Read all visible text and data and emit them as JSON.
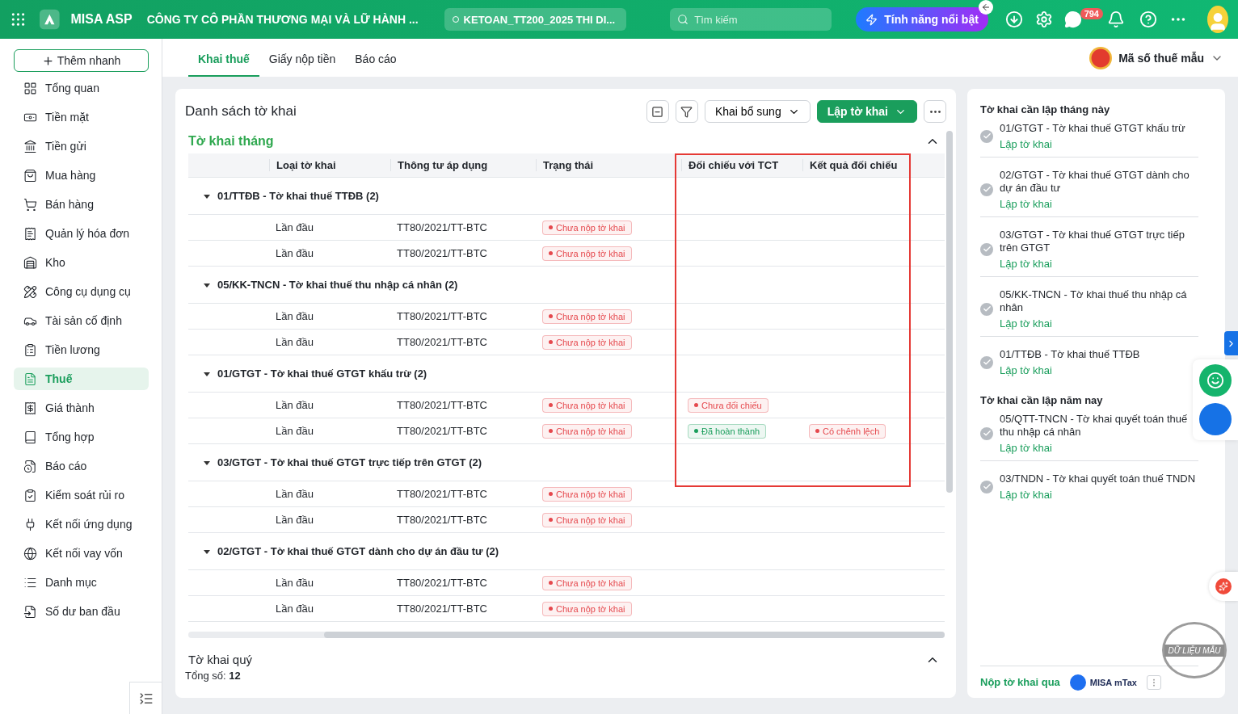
{
  "topbar": {
    "brand": "MISA ASP",
    "company": "CÔNG TY CÔ PHẦN THƯƠNG MẠI VÀ LỮ HÀNH ...",
    "database": "KETOAN_TT200_2025 THI DI...",
    "search": {
      "placeholder": "Tìm kiếm"
    },
    "feature_button": "Tính năng nổi bật",
    "notification_count": "794"
  },
  "sidebar": {
    "quick_add": "Thêm nhanh",
    "items": [
      {
        "label": "Tổng quan",
        "selected": false
      },
      {
        "label": "Tiền mặt",
        "selected": false
      },
      {
        "label": "Tiền gửi",
        "selected": false
      },
      {
        "label": "Mua hàng",
        "selected": false
      },
      {
        "label": "Bán hàng",
        "selected": false
      },
      {
        "label": "Quản lý hóa đơn",
        "selected": false
      },
      {
        "label": "Kho",
        "selected": false
      },
      {
        "label": "Công cụ dụng cụ",
        "selected": false
      },
      {
        "label": "Tài sản cố định",
        "selected": false
      },
      {
        "label": "Tiền lương",
        "selected": false
      },
      {
        "label": "Thuế",
        "selected": true
      },
      {
        "label": "Giá thành",
        "selected": false
      },
      {
        "label": "Tổng hợp",
        "selected": false
      },
      {
        "label": "Báo cáo",
        "selected": false
      },
      {
        "label": "Kiểm soát rủi ro",
        "selected": false
      },
      {
        "label": "Kết nối ứng dụng",
        "selected": false
      },
      {
        "label": "Kết nối vay vốn",
        "selected": false
      },
      {
        "label": "Danh mục",
        "selected": false
      },
      {
        "label": "Số dư ban đầu",
        "selected": false
      }
    ]
  },
  "tabs": [
    {
      "label": "Khai thuế",
      "selected": true
    },
    {
      "label": "Giấy nộp tiền",
      "selected": false
    },
    {
      "label": "Báo cáo",
      "selected": false
    }
  ],
  "tax_code": "Mã số thuế mẫu",
  "card": {
    "title": "Danh sách tờ khai",
    "buttons": {
      "supplement": "Khai bổ sung",
      "create": "Lập tờ khai"
    },
    "section": {
      "title": "Tờ khai tháng",
      "expanded": true
    },
    "columns": [
      {
        "label": "Loại tờ khai",
        "highlighted": false
      },
      {
        "label": "Thông tư áp dụng",
        "highlighted": false
      },
      {
        "label": "Trạng thái",
        "highlighted": false
      },
      {
        "label": "Đối chiếu với TCT",
        "highlighted": true
      },
      {
        "label": "Kết quả đối chiếu",
        "highlighted": true
      }
    ],
    "groups": [
      {
        "title": "01/TTĐB - Tờ khai thuế TTĐB",
        "count": "(2)",
        "expanded": true,
        "rows": [
          {
            "type": "Lần đầu",
            "circular": "TT80/2021/TT-BTC",
            "status": {
              "text": "Chưa nộp tờ khai",
              "color": "#e5484d"
            }
          },
          {
            "type": "Lần đầu",
            "circular": "TT80/2021/TT-BTC",
            "status": {
              "text": "Chưa nộp tờ khai",
              "color": "#e5484d"
            }
          }
        ]
      },
      {
        "title": "05/KK-TNCN - Tờ khai thuế thu nhập cá nhân",
        "count": "(2)",
        "expanded": true,
        "rows": [
          {
            "type": "Lần đầu",
            "circular": "TT80/2021/TT-BTC",
            "status": {
              "text": "Chưa nộp tờ khai",
              "color": "#e5484d"
            }
          },
          {
            "type": "Lần đầu",
            "circular": "TT80/2021/TT-BTC",
            "status": {
              "text": "Chưa nộp tờ khai",
              "color": "#e5484d"
            }
          }
        ]
      },
      {
        "title": "01/GTGT - Tờ khai thuế GTGT khấu trừ",
        "count": "(2)",
        "expanded": true,
        "rows": [
          {
            "type": "Lần đầu",
            "circular": "TT80/2021/TT-BTC",
            "status": {
              "text": "Chưa nộp tờ khai",
              "color": "#e5484d"
            },
            "compare": {
              "text": "Chưa đối chiếu",
              "color": "#e5484d"
            }
          },
          {
            "type": "Lần đầu",
            "circular": "TT80/2021/TT-BTC",
            "status": {
              "text": "Chưa nộp tờ khai",
              "color": "#e5484d"
            },
            "compare": {
              "text": "Đã hoàn thành",
              "color": "#1a9e5c"
            },
            "result": {
              "text": "Có chênh lệch",
              "color": "#e5484d"
            }
          }
        ]
      },
      {
        "title": "03/GTGT - Tờ khai thuế GTGT trực tiếp trên GTGT",
        "count": "(2)",
        "expanded": true,
        "rows": [
          {
            "type": "Lần đầu",
            "circular": "TT80/2021/TT-BTC",
            "status": {
              "text": "Chưa nộp tờ khai",
              "color": "#e5484d"
            }
          },
          {
            "type": "Lần đầu",
            "circular": "TT80/2021/TT-BTC",
            "status": {
              "text": "Chưa nộp tờ khai",
              "color": "#e5484d"
            }
          }
        ]
      },
      {
        "title": "02/GTGT - Tờ khai thuế GTGT dành cho dự án đầu tư",
        "count": "(2)",
        "expanded": true,
        "rows": [
          {
            "type": "Lần đầu",
            "circular": "TT80/2021/TT-BTC",
            "status": {
              "text": "Chưa nộp tờ khai",
              "color": "#e5484d"
            }
          },
          {
            "type": "Lần đầu",
            "circular": "TT80/2021/TT-BTC",
            "status": {
              "text": "Chưa nộp tờ khai",
              "color": "#e5484d"
            }
          }
        ]
      }
    ],
    "quarter": {
      "title": "Tờ khai quý",
      "expanded": false,
      "total_label": "Tổng số:",
      "total": "12"
    }
  },
  "right_panel": {
    "sections": [
      {
        "title": "Tờ khai cần lập tháng này",
        "items": [
          {
            "name": "01/GTGT - Tờ khai thuế GTGT khấu trừ",
            "action": "Lập tờ khai"
          },
          {
            "name": "02/GTGT - Tờ khai thuế GTGT dành cho dự án đầu tư",
            "action": "Lập tờ khai"
          },
          {
            "name": "03/GTGT - Tờ khai thuế GTGT trực tiếp trên GTGT",
            "action": "Lập tờ khai"
          },
          {
            "name": "05/KK-TNCN - Tờ khai thuế thu nhập cá nhân",
            "action": "Lập tờ khai"
          },
          {
            "name": "01/TTĐB - Tờ khai thuế TTĐB",
            "action": "Lập tờ khai"
          }
        ]
      },
      {
        "title": "Tờ khai cần lập năm nay",
        "items": [
          {
            "name": "05/QTT-TNCN - Tờ khai quyết toán thuế thu nhập cá nhân",
            "action": "Lập tờ khai"
          },
          {
            "name": "03/TNDN - Tờ khai quyết toán thuế TNDN",
            "action": "Lập tờ khai"
          }
        ]
      }
    ],
    "submit_via": "Nộp tờ khai qua",
    "provider": "MISA mTax",
    "stamp": "DỮ LIỆU MẪU"
  }
}
